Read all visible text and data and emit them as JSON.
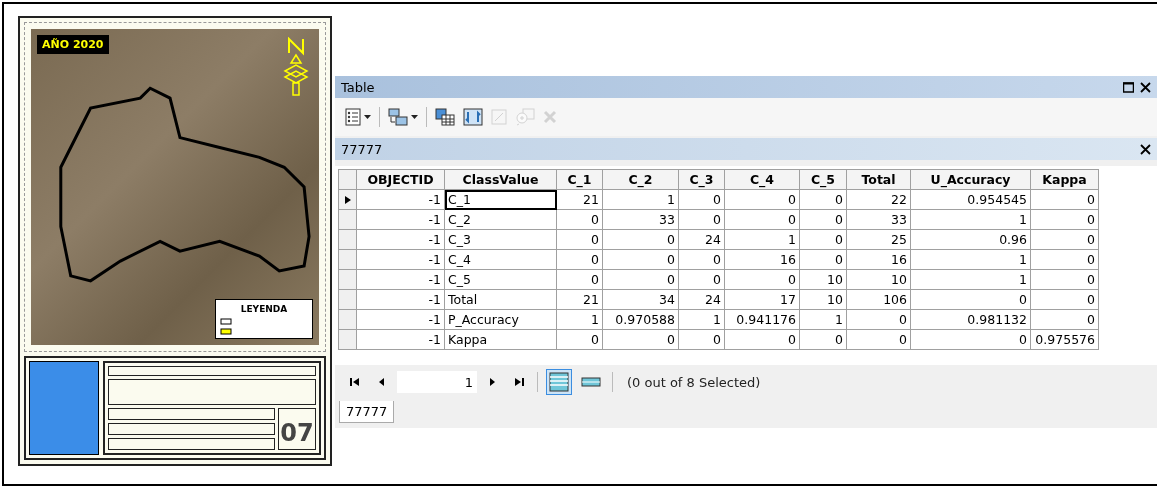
{
  "map_sheet": {
    "year_label": "AÑO 2020",
    "legend_title": "LEYENDA",
    "sheet_number": "07"
  },
  "window": {
    "title": "Table"
  },
  "toolbar": [
    {
      "kind": "options",
      "has_menu": true,
      "disabled": false
    },
    {
      "kind": "related",
      "has_menu": true,
      "disabled": false
    },
    {
      "kind": "select",
      "has_menu": false,
      "disabled": false
    },
    {
      "kind": "switch",
      "has_menu": false,
      "disabled": false
    },
    {
      "kind": "clear",
      "has_menu": false,
      "disabled": true
    },
    {
      "kind": "zoom",
      "has_menu": false,
      "disabled": true
    },
    {
      "kind": "delete",
      "has_menu": false,
      "disabled": true
    }
  ],
  "table_header": {
    "title": "77777"
  },
  "table": {
    "columns": [
      "OBJECTID",
      "ClassValue",
      "C_1",
      "C_2",
      "C_3",
      "C_4",
      "C_5",
      "Total",
      "U_Accuracy",
      "Kappa"
    ],
    "rows": [
      {
        "current": true,
        "cells": [
          "-1",
          "C_1",
          "21",
          "1",
          "0",
          "0",
          "0",
          "22",
          "0.954545",
          "0"
        ]
      },
      {
        "current": false,
        "cells": [
          "-1",
          "C_2",
          "0",
          "33",
          "0",
          "0",
          "0",
          "33",
          "1",
          "0"
        ]
      },
      {
        "current": false,
        "cells": [
          "-1",
          "C_3",
          "0",
          "0",
          "24",
          "1",
          "0",
          "25",
          "0.96",
          "0"
        ]
      },
      {
        "current": false,
        "cells": [
          "-1",
          "C_4",
          "0",
          "0",
          "0",
          "16",
          "0",
          "16",
          "1",
          "0"
        ]
      },
      {
        "current": false,
        "cells": [
          "-1",
          "C_5",
          "0",
          "0",
          "0",
          "0",
          "10",
          "10",
          "1",
          "0"
        ]
      },
      {
        "current": false,
        "cells": [
          "-1",
          "Total",
          "21",
          "34",
          "24",
          "17",
          "10",
          "106",
          "0",
          "0"
        ]
      },
      {
        "current": false,
        "cells": [
          "-1",
          "P_Accuracy",
          "1",
          "0.970588",
          "1",
          "0.941176",
          "1",
          "0",
          "0.981132",
          "0"
        ]
      },
      {
        "current": false,
        "cells": [
          "-1",
          "Kappa",
          "0",
          "0",
          "0",
          "0",
          "0",
          "0",
          "0",
          "0.975576"
        ]
      }
    ]
  },
  "navigation": {
    "record": "1",
    "views": [
      {
        "selected": true
      },
      {
        "selected": false
      }
    ],
    "status": "(0 out of 8 Selected)"
  },
  "table_tabs": [
    {
      "label": "77777",
      "selected": true
    }
  ]
}
